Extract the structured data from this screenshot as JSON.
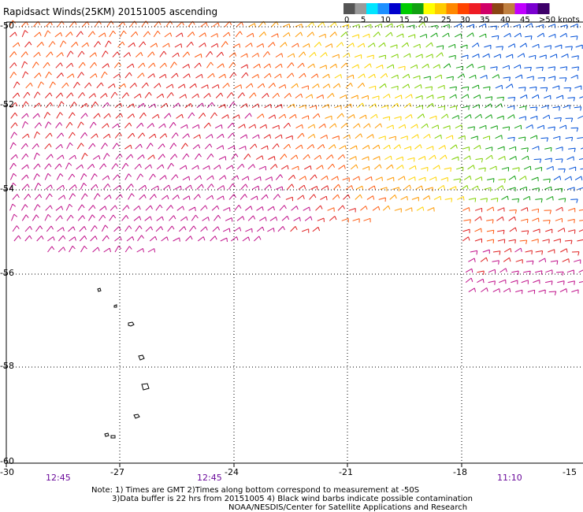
{
  "title": "Rapidsact Winds(25KM) 20151005 ascending",
  "legend": {
    "colors": [
      "#555555",
      "#9a9a9a",
      "#00e5ff",
      "#1e90ff",
      "#0000cd",
      "#00cc00",
      "#11a011",
      "#ffff00",
      "#ffcc00",
      "#ff8800",
      "#ff4400",
      "#ee1c24",
      "#d00068",
      "#8b4513",
      "#c08040",
      "#c000ff",
      "#7a00d0",
      "#3d006a"
    ],
    "labels": [
      "0",
      "5",
      "10",
      "15",
      "20",
      "25",
      "30",
      "35",
      "40",
      "45",
      ">50 knots"
    ]
  },
  "axes": {
    "lat_labels": [
      "-50",
      "-52",
      "-54",
      "-56",
      "-58",
      "-60"
    ],
    "lon_labels": [
      "-30",
      "-27",
      "-24",
      "-21",
      "-18",
      "-15"
    ]
  },
  "times": [
    "12:45",
    "12:45",
    "11:10"
  ],
  "notes": [
    "Note: 1) Times are GMT 2)Times along bottom correspond to measurement at -50S",
    "3)Data buffer is 22 hrs from 20151005 4) Black wind barbs indicate possible contamination",
    "NOAA/NESDIS/Center for Satellite Applications and Research"
  ]
}
